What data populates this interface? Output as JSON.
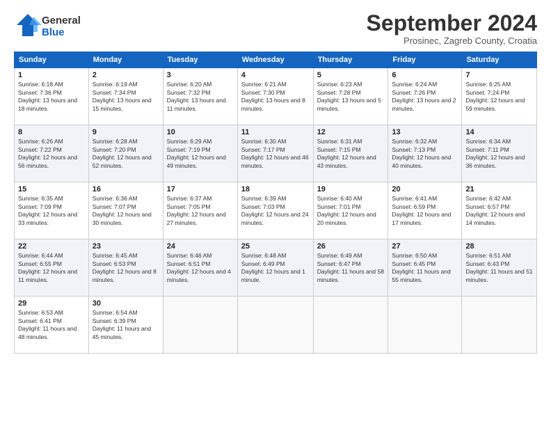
{
  "logo": {
    "general": "General",
    "blue": "Blue"
  },
  "header": {
    "month": "September 2024",
    "location": "Prosinec, Zagreb County, Croatia"
  },
  "weekdays": [
    "Sunday",
    "Monday",
    "Tuesday",
    "Wednesday",
    "Thursday",
    "Friday",
    "Saturday"
  ],
  "weeks": [
    [
      {
        "day": "1",
        "sunrise": "6:18 AM",
        "sunset": "7:36 PM",
        "daylight": "13 hours and 18 minutes."
      },
      {
        "day": "2",
        "sunrise": "6:19 AM",
        "sunset": "7:34 PM",
        "daylight": "13 hours and 15 minutes."
      },
      {
        "day": "3",
        "sunrise": "6:20 AM",
        "sunset": "7:32 PM",
        "daylight": "13 hours and 11 minutes."
      },
      {
        "day": "4",
        "sunrise": "6:21 AM",
        "sunset": "7:30 PM",
        "daylight": "13 hours and 8 minutes."
      },
      {
        "day": "5",
        "sunrise": "6:23 AM",
        "sunset": "7:28 PM",
        "daylight": "13 hours and 5 minutes."
      },
      {
        "day": "6",
        "sunrise": "6:24 AM",
        "sunset": "7:26 PM",
        "daylight": "13 hours and 2 minutes."
      },
      {
        "day": "7",
        "sunrise": "6:25 AM",
        "sunset": "7:24 PM",
        "daylight": "12 hours and 59 minutes."
      }
    ],
    [
      {
        "day": "8",
        "sunrise": "6:26 AM",
        "sunset": "7:22 PM",
        "daylight": "12 hours and 56 minutes."
      },
      {
        "day": "9",
        "sunrise": "6:28 AM",
        "sunset": "7:20 PM",
        "daylight": "12 hours and 52 minutes."
      },
      {
        "day": "10",
        "sunrise": "6:29 AM",
        "sunset": "7:19 PM",
        "daylight": "12 hours and 49 minutes."
      },
      {
        "day": "11",
        "sunrise": "6:30 AM",
        "sunset": "7:17 PM",
        "daylight": "12 hours and 46 minutes."
      },
      {
        "day": "12",
        "sunrise": "6:31 AM",
        "sunset": "7:15 PM",
        "daylight": "12 hours and 43 minutes."
      },
      {
        "day": "13",
        "sunrise": "6:32 AM",
        "sunset": "7:13 PM",
        "daylight": "12 hours and 40 minutes."
      },
      {
        "day": "14",
        "sunrise": "6:34 AM",
        "sunset": "7:11 PM",
        "daylight": "12 hours and 36 minutes."
      }
    ],
    [
      {
        "day": "15",
        "sunrise": "6:35 AM",
        "sunset": "7:09 PM",
        "daylight": "12 hours and 33 minutes."
      },
      {
        "day": "16",
        "sunrise": "6:36 AM",
        "sunset": "7:07 PM",
        "daylight": "12 hours and 30 minutes."
      },
      {
        "day": "17",
        "sunrise": "6:37 AM",
        "sunset": "7:05 PM",
        "daylight": "12 hours and 27 minutes."
      },
      {
        "day": "18",
        "sunrise": "6:39 AM",
        "sunset": "7:03 PM",
        "daylight": "12 hours and 24 minutes."
      },
      {
        "day": "19",
        "sunrise": "6:40 AM",
        "sunset": "7:01 PM",
        "daylight": "12 hours and 20 minutes."
      },
      {
        "day": "20",
        "sunrise": "6:41 AM",
        "sunset": "6:59 PM",
        "daylight": "12 hours and 17 minutes."
      },
      {
        "day": "21",
        "sunrise": "6:42 AM",
        "sunset": "6:57 PM",
        "daylight": "12 hours and 14 minutes."
      }
    ],
    [
      {
        "day": "22",
        "sunrise": "6:44 AM",
        "sunset": "6:55 PM",
        "daylight": "12 hours and 11 minutes."
      },
      {
        "day": "23",
        "sunrise": "6:45 AM",
        "sunset": "6:53 PM",
        "daylight": "12 hours and 8 minutes."
      },
      {
        "day": "24",
        "sunrise": "6:46 AM",
        "sunset": "6:51 PM",
        "daylight": "12 hours and 4 minutes."
      },
      {
        "day": "25",
        "sunrise": "6:48 AM",
        "sunset": "6:49 PM",
        "daylight": "12 hours and 1 minute."
      },
      {
        "day": "26",
        "sunrise": "6:49 AM",
        "sunset": "6:47 PM",
        "daylight": "11 hours and 58 minutes."
      },
      {
        "day": "27",
        "sunrise": "6:50 AM",
        "sunset": "6:45 PM",
        "daylight": "11 hours and 55 minutes."
      },
      {
        "day": "28",
        "sunrise": "6:51 AM",
        "sunset": "6:43 PM",
        "daylight": "11 hours and 51 minutes."
      }
    ],
    [
      {
        "day": "29",
        "sunrise": "6:53 AM",
        "sunset": "6:41 PM",
        "daylight": "11 hours and 48 minutes."
      },
      {
        "day": "30",
        "sunrise": "6:54 AM",
        "sunset": "6:39 PM",
        "daylight": "11 hours and 45 minutes."
      },
      null,
      null,
      null,
      null,
      null
    ]
  ]
}
